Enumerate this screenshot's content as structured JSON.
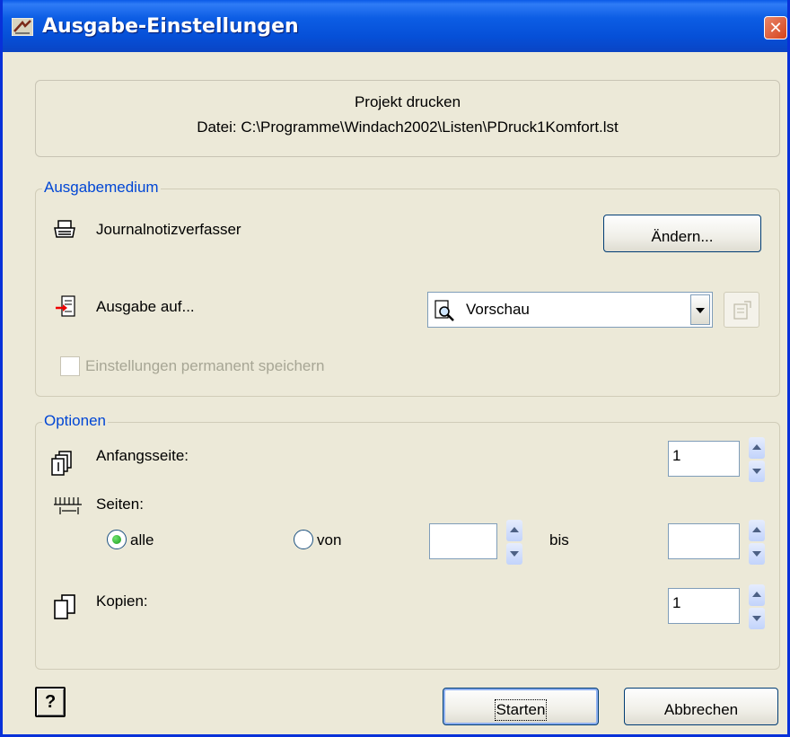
{
  "window": {
    "title": "Ausgabe-Einstellungen",
    "close_symbol": "✕"
  },
  "info": {
    "line1": "Projekt drucken",
    "line2": "Datei: C:\\Programme\\Windach2002\\Listen\\PDruck1Komfort.lst"
  },
  "ausgabemedium": {
    "legend": "Ausgabemedium",
    "printer_icon": "printer-icon",
    "printer_name": "Journalnotizverfasser",
    "change_button": "Ändern...",
    "output_icon": "output-target-icon",
    "output_label": "Ausgabe auf...",
    "output_selected": "Vorschau",
    "output_selected_icon": "preview-magnifier-icon",
    "properties_icon": "properties-icon",
    "save_permanent_label": "Einstellungen permanent speichern",
    "save_permanent_checked": false
  },
  "optionen": {
    "legend": "Optionen",
    "start_page_label": "Anfangsseite:",
    "start_page_value": "1",
    "pages_label": "Seiten:",
    "radio_all_label": "alle",
    "radio_all_checked": true,
    "radio_from_label": "von",
    "radio_from_checked": false,
    "from_value": "",
    "to_label": "bis",
    "to_value": "",
    "copies_label": "Kopien:",
    "copies_value": "1"
  },
  "footer": {
    "help_symbol": "?",
    "start_button": "Starten",
    "cancel_button": "Abbrechen"
  },
  "colors": {
    "titlebar": "#0650d8",
    "dialog_bg": "#ece9d8",
    "group_legend": "#0046d5",
    "close_button": "#d6431b",
    "disabled_text": "#a7a695"
  }
}
